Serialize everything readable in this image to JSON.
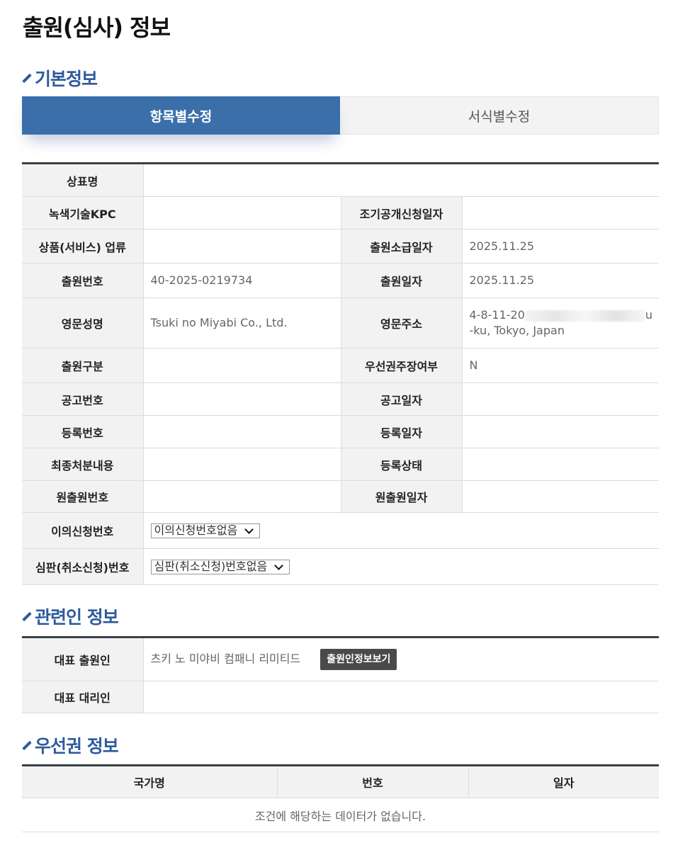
{
  "page_title": "출원(심사) 정보",
  "sections": {
    "basic": "기본정보",
    "related": "관련인 정보",
    "priority": "우선권 정보"
  },
  "tabs": [
    {
      "label": "항목별수정",
      "active": true
    },
    {
      "label": "서식별수정",
      "active": false
    }
  ],
  "basic_info": {
    "trademark_name": {
      "label": "상표명",
      "value": ""
    },
    "green_kpc": {
      "label": "녹색기술KPC",
      "value": ""
    },
    "early_pub_date": {
      "label": "조기공개신청일자",
      "value": ""
    },
    "goods_class": {
      "label": "상품(서비스) 업류",
      "value": ""
    },
    "retro_date": {
      "label": "출원소급일자",
      "value": "2025.11.25"
    },
    "app_number": {
      "label": "출원번호",
      "value": "40-2025-0219734"
    },
    "app_date": {
      "label": "출원일자",
      "value": "2025.11.25"
    },
    "en_name": {
      "label": "영문성명",
      "value": "Tsuki no Miyabi Co., Ltd."
    },
    "en_address": {
      "label": "영문주소",
      "value_line1_start": "4-8-11-20",
      "value_line1_end": "u",
      "value_line2": "-ku, Tokyo, Japan"
    },
    "app_type": {
      "label": "출원구분",
      "value": ""
    },
    "priority_claim": {
      "label": "우선권주장여부",
      "value": "N"
    },
    "pub_number": {
      "label": "공고번호",
      "value": ""
    },
    "pub_date": {
      "label": "공고일자",
      "value": ""
    },
    "reg_number": {
      "label": "등록번호",
      "value": ""
    },
    "reg_date": {
      "label": "등록일자",
      "value": ""
    },
    "final_disposition": {
      "label": "최종처분내용",
      "value": ""
    },
    "reg_status": {
      "label": "등록상태",
      "value": ""
    },
    "orig_app_number": {
      "label": "원출원번호",
      "value": ""
    },
    "orig_app_date": {
      "label": "원출원일자",
      "value": ""
    },
    "opposition": {
      "label": "이의신청번호",
      "selected": "이의신청번호없음"
    },
    "trial": {
      "label": "심판(취소신청)번호",
      "selected": "심판(취소신청)번호없음"
    }
  },
  "related": {
    "rep_applicant": {
      "label": "대표 출원인",
      "value": "츠키 노 미야비 컴패니 리미티드",
      "button": "출원인정보보기"
    },
    "rep_agent": {
      "label": "대표 대리인",
      "value": ""
    }
  },
  "priority_table": {
    "headers": [
      "국가명",
      "번호",
      "일자"
    ],
    "empty_message": "조건에 해당하는 데이터가 없습니다."
  }
}
